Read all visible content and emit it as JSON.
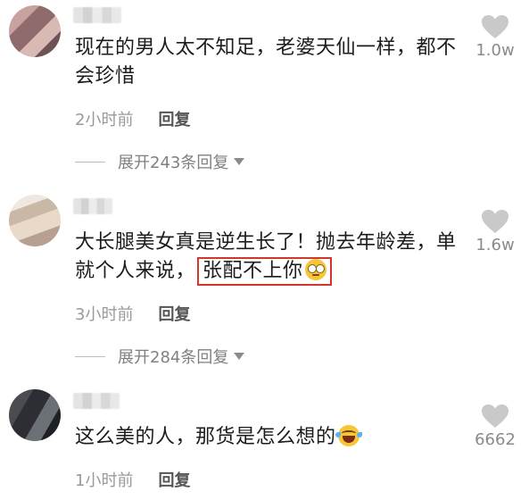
{
  "comments": [
    {
      "text": "现在的男人太不知足，老婆天仙一样，都不会珍惜",
      "time": "2小时前",
      "reply": "回复",
      "expand": "展开243条回复",
      "likes": "1.0w"
    },
    {
      "text_before": "大长腿美女真是逆生长了！抛去年龄差，单就个人来说，",
      "highlight": "张配不上你",
      "time": "3小时前",
      "reply": "回复",
      "expand": "展开284条回复",
      "likes": "1.6w"
    },
    {
      "text": "这么美的人，那货是怎么想的",
      "time": "1小时前",
      "reply": "回复",
      "likes": "6662"
    }
  ],
  "icons": {
    "like": "heart-icon",
    "expand": "caret-down-icon",
    "emoji_1": "eye-roll-emoji",
    "emoji_2": "laughing-tears-emoji"
  },
  "colors": {
    "highlight_border": "#d4362e",
    "meta_text": "#9a9a9a",
    "heart": "#c9c9c9"
  }
}
